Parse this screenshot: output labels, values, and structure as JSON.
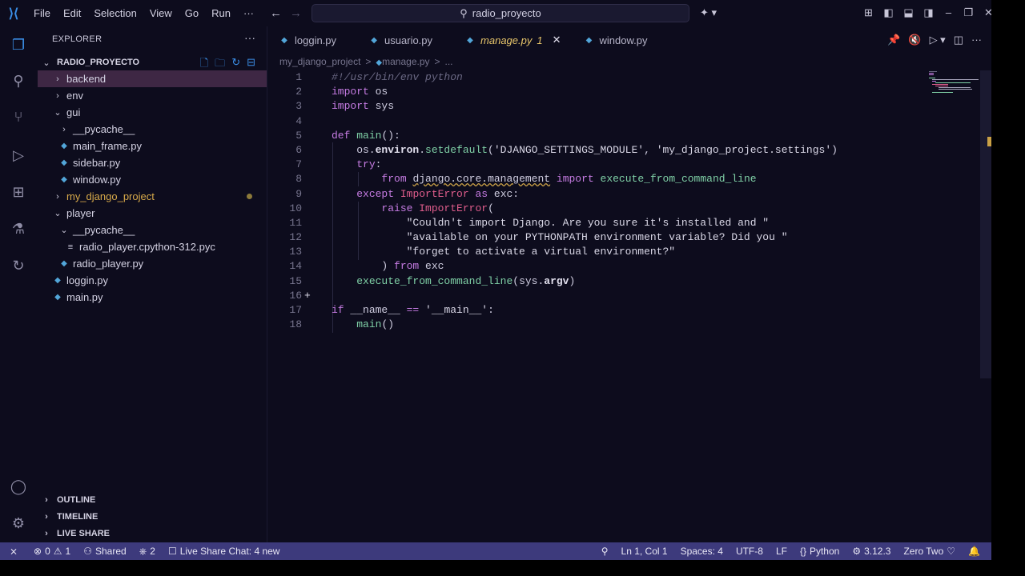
{
  "titlebar": {
    "menu": [
      "File",
      "Edit",
      "Selection",
      "View",
      "Go",
      "Run",
      "···"
    ],
    "search": "radio_proyecto"
  },
  "sidebar": {
    "title": "EXPLORER",
    "project": "RADIO_PROYECTO",
    "tree": [
      {
        "label": "backend",
        "type": "folder",
        "depth": 0,
        "open": false,
        "selected": true
      },
      {
        "label": "env",
        "type": "folder",
        "depth": 0,
        "open": false
      },
      {
        "label": "gui",
        "type": "folder",
        "depth": 0,
        "open": true
      },
      {
        "label": "__pycache__",
        "type": "folder",
        "depth": 1,
        "open": false
      },
      {
        "label": "main_frame.py",
        "type": "file",
        "depth": 1
      },
      {
        "label": "sidebar.py",
        "type": "file",
        "depth": 1
      },
      {
        "label": "window.py",
        "type": "file",
        "depth": 1
      },
      {
        "label": "my_django_project",
        "type": "folder",
        "depth": 0,
        "open": false,
        "modified": true
      },
      {
        "label": "player",
        "type": "folder",
        "depth": 0,
        "open": true
      },
      {
        "label": "__pycache__",
        "type": "folder",
        "depth": 1,
        "open": true
      },
      {
        "label": "radio_player.cpython-312.pyc",
        "type": "pyc",
        "depth": 2
      },
      {
        "label": "radio_player.py",
        "type": "file",
        "depth": 1
      },
      {
        "label": "loggin.py",
        "type": "file",
        "depth": 0
      },
      {
        "label": "main.py",
        "type": "file",
        "depth": 0
      }
    ],
    "sections": [
      "OUTLINE",
      "TIMELINE",
      "LIVE SHARE"
    ]
  },
  "tabs": [
    {
      "label": "loggin.py",
      "active": false
    },
    {
      "label": "usuario.py",
      "active": false
    },
    {
      "label": "manage.py",
      "badge": "1",
      "active": true
    },
    {
      "label": "window.py",
      "active": false
    }
  ],
  "breadcrumb": [
    "my_django_project",
    ">",
    "manage.py",
    ">",
    "..."
  ],
  "code": {
    "line_numbers": [
      "1",
      "2",
      "3",
      "4",
      "5",
      "6",
      "7",
      "8",
      "9",
      "10",
      "11",
      "12",
      "13",
      "14",
      "15",
      "16",
      "17",
      "18"
    ]
  },
  "status": {
    "errors": "0",
    "warnings": "1",
    "shared": "Shared",
    "ports": "2",
    "live_share_chat": "Live Share Chat: 4 new",
    "position": "Ln 1, Col 1",
    "spaces": "Spaces: 4",
    "encoding": "UTF-8",
    "eol": "LF",
    "language": "Python",
    "version": "3.12.3",
    "theme": "Zero Two"
  },
  "colors": {
    "accent": "#3b8fe8",
    "status_bar": "#3d3a7c",
    "selected_row": "#3e2744",
    "keyword": "#c67ce3",
    "function": "#7fd0a6",
    "error_class": "#e05d8c"
  }
}
